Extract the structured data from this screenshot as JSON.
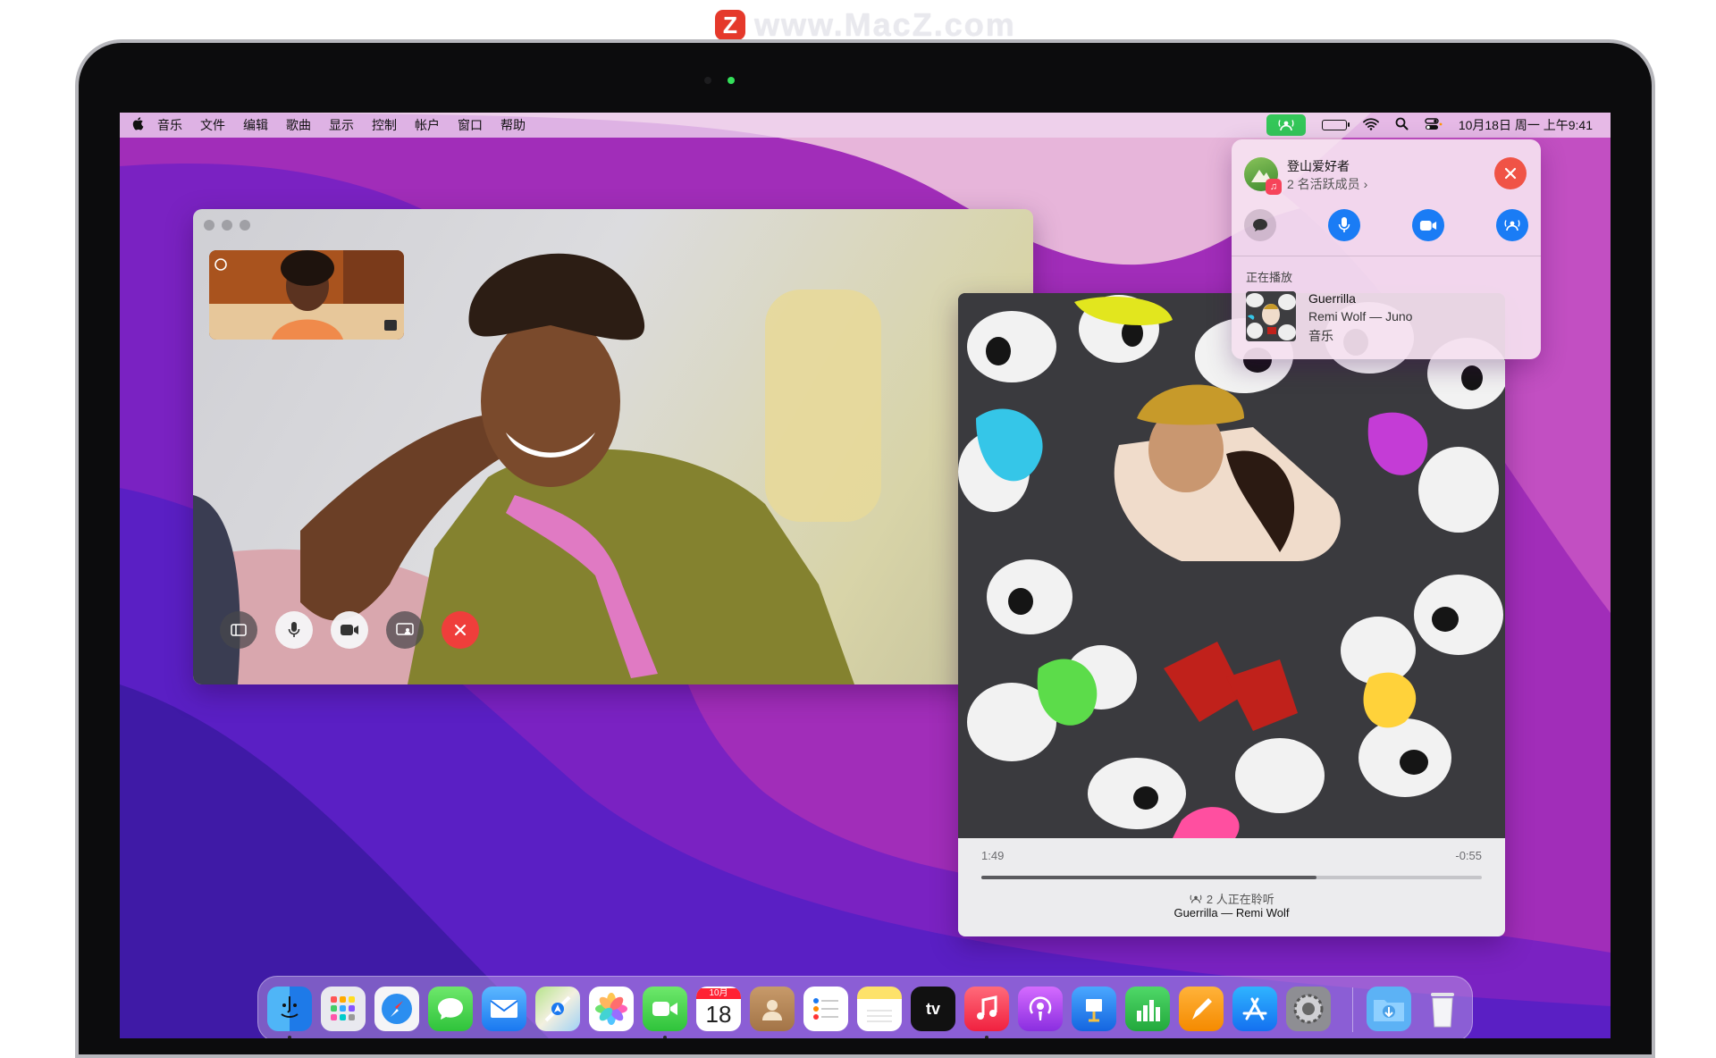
{
  "watermark": {
    "logo_letter": "Z",
    "text": "www.MacZ.com"
  },
  "menubar": {
    "apple": "",
    "items": [
      "音乐",
      "文件",
      "编辑",
      "歌曲",
      "显示",
      "控制",
      "帐户",
      "窗口",
      "帮助"
    ],
    "clock": "10月18日 周一 上午9:41"
  },
  "facetime": {
    "controls": [
      "sidebar",
      "microphone",
      "video",
      "screen-share",
      "end-call"
    ]
  },
  "music_window": {
    "elapsed": "1:49",
    "remaining": "-0:55",
    "progress": 0.67,
    "listening_text": "2 人正在聆听",
    "now_playing": "Guerrilla — Remi Wolf"
  },
  "shareplay_panel": {
    "group_name": "登山爱好者",
    "members_text": "2 名活跃成员 ›",
    "now_playing_label": "正在播放",
    "track_title": "Guerrilla",
    "track_artist": "Remi Wolf — Juno",
    "track_app": "音乐"
  },
  "dock": {
    "apps": [
      "Finder",
      "Launchpad",
      "Safari",
      "Messages",
      "Mail",
      "Maps",
      "Photos",
      "FaceTime",
      "Calendar",
      "Contacts",
      "Reminders",
      "Notes",
      "TV",
      "Music",
      "Podcasts",
      "Keynote",
      "Numbers",
      "Pages",
      "App Store",
      "System Preferences",
      "Downloads",
      "Trash"
    ],
    "calendar_month": "10月",
    "calendar_day": "18",
    "tv_label": "tv"
  },
  "colors": {
    "wallpaper_magenta": "#a12db9",
    "wallpaper_purple": "#5a1fc4",
    "accent_green": "#34c759",
    "accent_blue": "#1a7cf5",
    "end_red": "#ef3e3b"
  }
}
